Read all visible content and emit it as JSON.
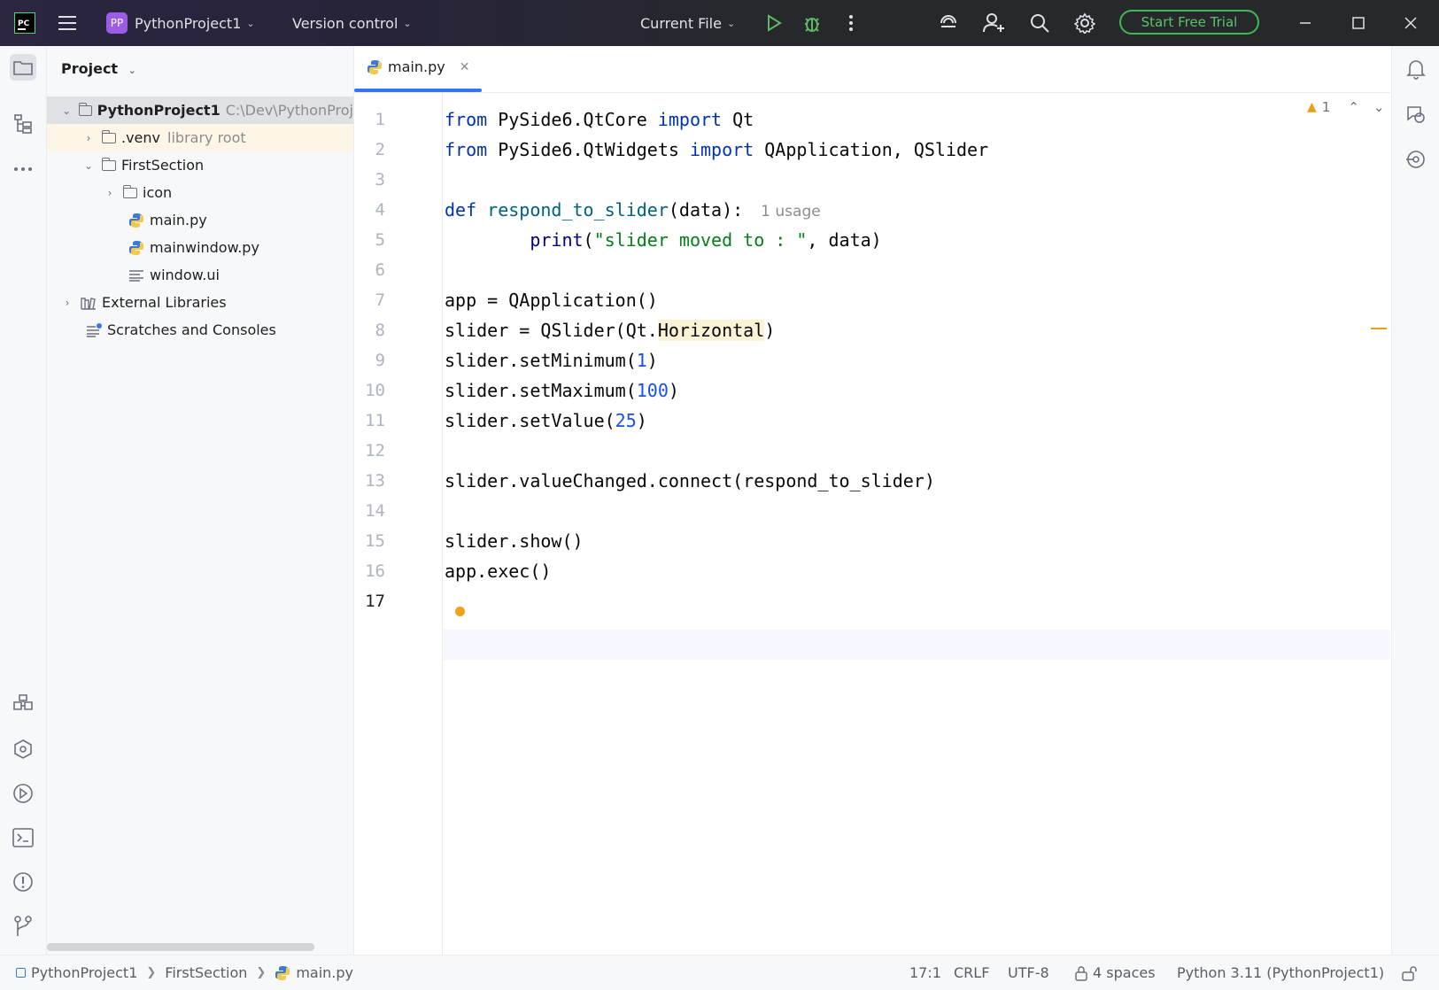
{
  "titlebar": {
    "app_logo": "PC",
    "project_initials": "PP",
    "project_name": "PythonProject1",
    "vcs_label": "Version control",
    "run_config": "Current File",
    "trial_button": "Start Free Trial"
  },
  "project_panel": {
    "title": "Project",
    "tree": [
      {
        "label": "PythonProject1",
        "extra": "C:\\Dev\\PythonProj",
        "type": "folder",
        "expanded": true
      },
      {
        "label": ".venv",
        "extra": "library root",
        "type": "folder",
        "expanded": false
      },
      {
        "label": "FirstSection",
        "type": "folder",
        "expanded": true
      },
      {
        "label": "icon",
        "type": "folder",
        "expanded": false
      },
      {
        "label": "main.py",
        "type": "python"
      },
      {
        "label": "mainwindow.py",
        "type": "python"
      },
      {
        "label": "window.ui",
        "type": "ui"
      },
      {
        "label": "External Libraries",
        "type": "library"
      },
      {
        "label": "Scratches and Consoles",
        "type": "scratches"
      }
    ]
  },
  "editor": {
    "tab_label": "main.py",
    "warning_count": "1",
    "usage_hint": "1 usage",
    "line_numbers": [
      "1",
      "2",
      "3",
      "4",
      "5",
      "6",
      "7",
      "8",
      "9",
      "10",
      "11",
      "12",
      "13",
      "14",
      "15",
      "16",
      "17"
    ],
    "current_line": "17",
    "code": [
      "from PySide6.QtCore import Qt",
      "from PySide6.QtWidgets import QApplication, QSlider",
      "",
      "def respond_to_slider(data):",
      "        print(\"slider moved to : \", data)",
      "",
      "app = QApplication()",
      "slider = QSlider(Qt.Horizontal)",
      "slider.setMinimum(1)",
      "slider.setMaximum(100)",
      "slider.setValue(25)",
      "",
      "slider.valueChanged.connect(respond_to_slider)",
      "",
      "slider.show()",
      "app.exec()",
      ""
    ]
  },
  "statusbar": {
    "breadcrumbs": [
      "PythonProject1",
      "FirstSection",
      "main.py"
    ],
    "position": "17:1",
    "line_ending": "CRLF",
    "encoding": "UTF-8",
    "indent": "4 spaces",
    "interpreter": "Python 3.11 (PythonProject1)"
  },
  "icons": {
    "left_strip": [
      "project-folder-icon",
      "structure-icon",
      "more-icon",
      "python-packages-icon",
      "python-console-icon",
      "services-icon",
      "terminal-icon",
      "problems-icon",
      "git-icon"
    ],
    "right_strip": [
      "notifications-icon",
      "ai-assistant-icon",
      "endpoints-icon"
    ]
  },
  "colors": {
    "accent": "#3574f0",
    "trial_green": "#3fb950",
    "keyword": "#0033b3",
    "string": "#067d17",
    "number": "#1750eb",
    "warning": "#e4a214"
  }
}
